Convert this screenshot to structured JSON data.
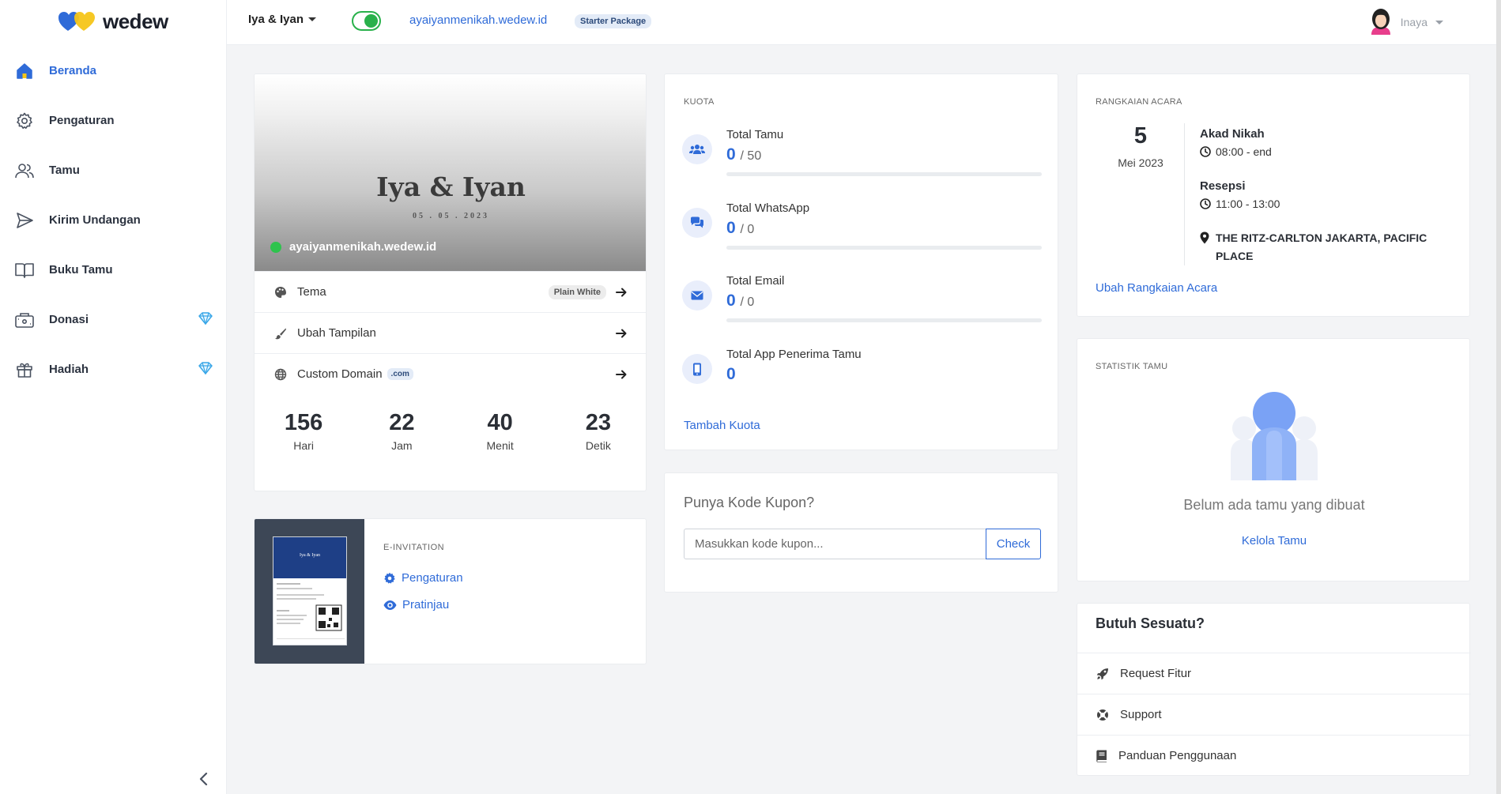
{
  "brand": {
    "name": "wedew"
  },
  "sidebar": {
    "items": [
      {
        "label": "Beranda",
        "icon": "home-icon",
        "active": true,
        "premium": false
      },
      {
        "label": "Pengaturan",
        "icon": "gear-icon",
        "active": false,
        "premium": false
      },
      {
        "label": "Tamu",
        "icon": "users-icon",
        "active": false,
        "premium": false
      },
      {
        "label": "Kirim Undangan",
        "icon": "send-icon",
        "active": false,
        "premium": false
      },
      {
        "label": "Buku Tamu",
        "icon": "book-icon",
        "active": false,
        "premium": false
      },
      {
        "label": "Donasi",
        "icon": "wallet-icon",
        "active": false,
        "premium": true
      },
      {
        "label": "Hadiah",
        "icon": "gift-icon",
        "active": false,
        "premium": true
      }
    ]
  },
  "topbar": {
    "couple": "Iya & Iyan",
    "site_url": "ayaiyanmenikah.wedew.id",
    "package": "Starter Package",
    "user_name": "Inaya",
    "toggle_on": true
  },
  "hero": {
    "names": "Iya & Iyan",
    "date": "05 . 05 . 2023",
    "url": "ayaiyanmenikah.wedew.id",
    "rows": {
      "tema": "Tema",
      "tema_badge": "Plain White",
      "ubah": "Ubah Tampilan",
      "domain": "Custom Domain",
      "domain_badge": ".com"
    },
    "countdown": [
      {
        "value": "156",
        "label": "Hari"
      },
      {
        "value": "22",
        "label": "Jam"
      },
      {
        "value": "40",
        "label": "Menit"
      },
      {
        "value": "23",
        "label": "Detik"
      }
    ]
  },
  "einvitation": {
    "title": "E-INVITATION",
    "paper_names": "Iya & Iyan",
    "links": [
      "Pengaturan",
      "Pratinjau"
    ]
  },
  "kuota": {
    "title": "KUOTA",
    "items": [
      {
        "label": "Total Tamu",
        "value": "0",
        "max": "/ 50",
        "fill": 0
      },
      {
        "label": "Total WhatsApp",
        "value": "0",
        "max": "/ 0",
        "fill": 0
      },
      {
        "label": "Total Email",
        "value": "0",
        "max": "/ 0",
        "fill": 0
      },
      {
        "label": "Total App Penerima Tamu",
        "value": "0",
        "max": "",
        "fill": null
      }
    ],
    "link": "Tambah Kuota"
  },
  "kupon": {
    "title": "Punya Kode Kupon?",
    "placeholder": "Masukkan kode kupon...",
    "button": "Check"
  },
  "rangkaian": {
    "title": "RANGKAIAN ACARA",
    "day": "5",
    "month": "Mei 2023",
    "events": [
      {
        "name": "Akad Nikah",
        "time": "08:00 - end"
      },
      {
        "name": "Resepsi",
        "time": "11:00 - 13:00"
      }
    ],
    "place": "THE RITZ-CARLTON JAKARTA, PACIFIC PLACE",
    "link": "Ubah Rangkaian Acara"
  },
  "statistik": {
    "title": "STATISTIK TAMU",
    "empty": "Belum ada tamu yang dibuat",
    "link": "Kelola Tamu"
  },
  "butuh": {
    "title": "Butuh Sesuatu?",
    "items": [
      "Request Fitur",
      "Support",
      "Panduan Penggunaan"
    ]
  },
  "colors": {
    "accent": "#2f6bd8",
    "success": "#29b14b",
    "premium": "#3aa7e8"
  }
}
